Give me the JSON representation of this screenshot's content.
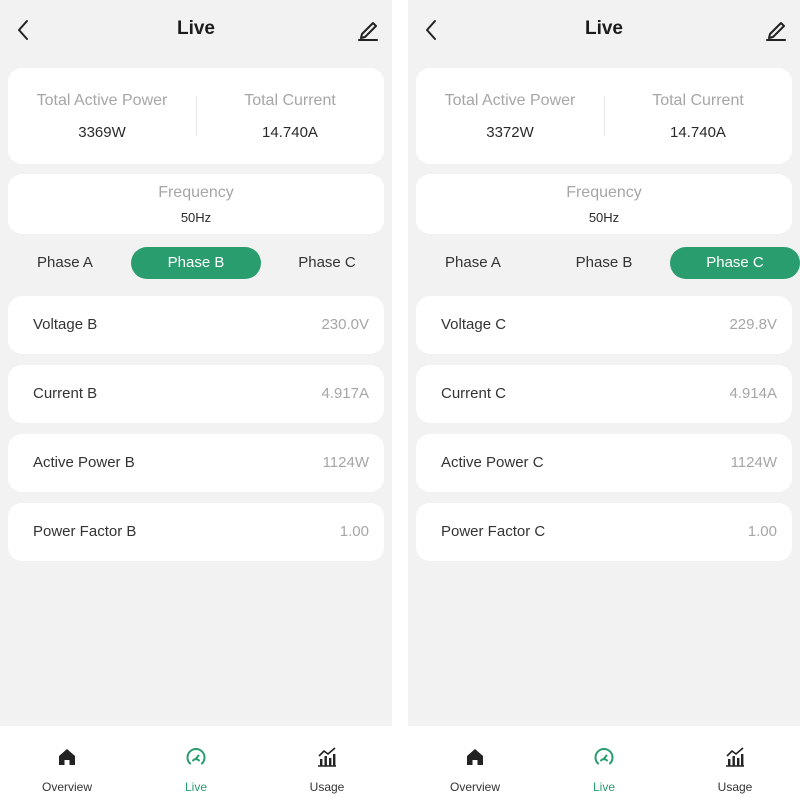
{
  "colors": {
    "accent": "#2a9d6e",
    "muted_text": "#a6a6a6",
    "card_bg": "#ffffff",
    "page_bg": "#f2f2f2"
  },
  "screens": [
    {
      "header": {
        "title": "Live"
      },
      "totals": {
        "active_power_label": "Total Active Power",
        "active_power_value": "3369W",
        "current_label": "Total Current",
        "current_value": "14.740A"
      },
      "frequency": {
        "label": "Frequency",
        "value": "50Hz"
      },
      "phases": {
        "a": "Phase A",
        "b": "Phase B",
        "c": "Phase C",
        "selected": "Phase B"
      },
      "rows": [
        {
          "label": "Voltage B",
          "value": "230.0V"
        },
        {
          "label": "Current B",
          "value": "4.917A"
        },
        {
          "label": "Active Power B",
          "value": "1124W"
        },
        {
          "label": "Power Factor B",
          "value": "1.00"
        }
      ],
      "nav": {
        "overview": "Overview",
        "live": "Live",
        "usage": "Usage",
        "active": "Live"
      }
    },
    {
      "header": {
        "title": "Live"
      },
      "totals": {
        "active_power_label": "Total Active Power",
        "active_power_value": "3372W",
        "current_label": "Total Current",
        "current_value": "14.740A"
      },
      "frequency": {
        "label": "Frequency",
        "value": "50Hz"
      },
      "phases": {
        "a": "Phase A",
        "b": "Phase B",
        "c": "Phase C",
        "selected": "Phase C"
      },
      "rows": [
        {
          "label": "Voltage C",
          "value": "229.8V"
        },
        {
          "label": "Current C",
          "value": "4.914A"
        },
        {
          "label": "Active Power C",
          "value": "1124W"
        },
        {
          "label": "Power Factor C",
          "value": "1.00"
        }
      ],
      "nav": {
        "overview": "Overview",
        "live": "Live",
        "usage": "Usage",
        "active": "Live"
      }
    }
  ],
  "icons": {
    "back": "chevron-left-icon",
    "edit": "pencil-icon",
    "overview": "home-icon",
    "live": "gauge-icon",
    "usage": "bar-chart-icon"
  }
}
